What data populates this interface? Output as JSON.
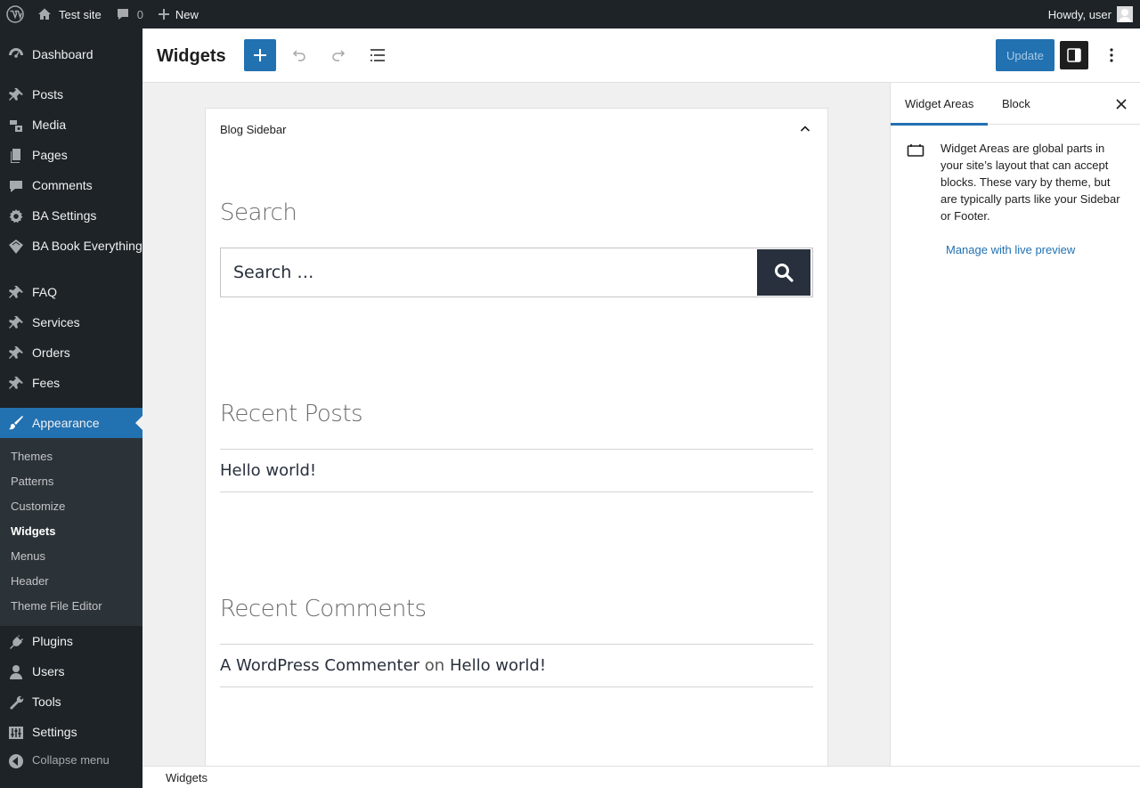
{
  "admin_bar": {
    "site_name": "Test site",
    "comments_count": "0",
    "new_label": "New",
    "greeting": "Howdy, user"
  },
  "admin_menu": {
    "items": [
      {
        "label": "Dashboard",
        "icon": "dashboard-icon"
      },
      {
        "label": "Posts",
        "icon": "pin-icon"
      },
      {
        "label": "Media",
        "icon": "media-icon"
      },
      {
        "label": "Pages",
        "icon": "pages-icon"
      },
      {
        "label": "Comments",
        "icon": "comment-icon"
      },
      {
        "label": "BA Settings",
        "icon": "gear-icon"
      },
      {
        "label": "BA Book Everything",
        "icon": "ticket-icon"
      },
      {
        "label": "FAQ",
        "icon": "pin-icon"
      },
      {
        "label": "Services",
        "icon": "pin-icon"
      },
      {
        "label": "Orders",
        "icon": "pin-icon"
      },
      {
        "label": "Fees",
        "icon": "pin-icon"
      },
      {
        "label": "Appearance",
        "icon": "brush-icon"
      },
      {
        "label": "Plugins",
        "icon": "plugin-icon"
      },
      {
        "label": "Users",
        "icon": "user-icon"
      },
      {
        "label": "Tools",
        "icon": "wrench-icon"
      },
      {
        "label": "Settings",
        "icon": "settings-sliders-icon"
      },
      {
        "label": "Collapse menu",
        "icon": "collapse-icon"
      }
    ],
    "submenu": [
      "Themes",
      "Patterns",
      "Customize",
      "Widgets",
      "Menus",
      "Header",
      "Theme File Editor"
    ]
  },
  "header": {
    "title": "Widgets",
    "update_label": "Update"
  },
  "canvas": {
    "area_title": "Blog Sidebar",
    "search_heading": "Search",
    "search_placeholder": "Search …",
    "recent_posts_heading": "Recent Posts",
    "recent_post": "Hello world!",
    "recent_comments_heading": "Recent Comments",
    "comment_author": "A WordPress Commenter",
    "comment_on": "on",
    "comment_post": "Hello world!"
  },
  "sidebar": {
    "tab_widget_areas": "Widget Areas",
    "tab_block": "Block",
    "description": "Widget Areas are global parts in your site’s layout that can accept blocks. These vary by theme, but are typically parts like your Sidebar or Footer.",
    "manage_link": "Manage with live preview"
  },
  "footer": {
    "breadcrumb": "Widgets"
  },
  "colors": {
    "admin_dark": "#1d2327",
    "accent": "#2271b1",
    "submenu_bg": "#2c3338"
  }
}
